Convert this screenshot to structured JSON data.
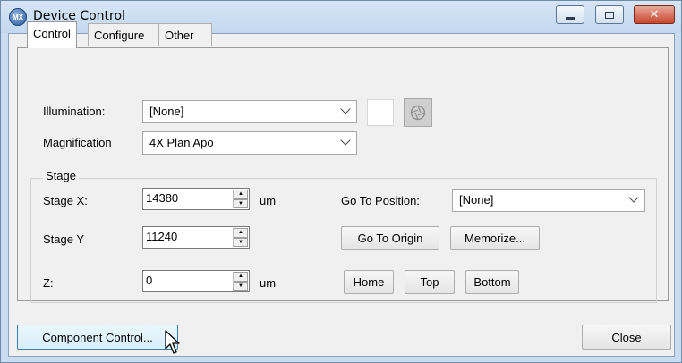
{
  "window": {
    "title": "Device Control",
    "app_icon_text": "MX",
    "minimize_icon": "minimize-icon",
    "maximize_icon": "maximize-icon",
    "close_icon": "close-icon",
    "close_glyph": "✕"
  },
  "tabs": [
    {
      "label": "Control",
      "active": true
    },
    {
      "label": "Configure",
      "active": false
    },
    {
      "label": "Other",
      "active": false
    }
  ],
  "control": {
    "illumination_label": "Illumination:",
    "illumination_value": "[None]",
    "magnification_label": "Magnification",
    "magnification_value": "4X Plan Apo",
    "stage": {
      "title": "Stage",
      "x_label": "Stage X:",
      "x_value": "14380",
      "x_unit": "um",
      "y_label": "Stage Y",
      "y_value": "11240",
      "z_label": "Z:",
      "z_value": "0",
      "z_unit": "um",
      "goto_label": "Go To Position:",
      "goto_value": "[None]",
      "go_to_origin": "Go To Origin",
      "memorize": "Memorize...",
      "home": "Home",
      "top": "Top",
      "bottom": "Bottom"
    }
  },
  "footer": {
    "component_control": "Component Control...",
    "close": "Close"
  },
  "colors": {
    "title_bar": "#c9dcf0",
    "close_button": "#c7452d",
    "panel": "#f0f0f0"
  }
}
